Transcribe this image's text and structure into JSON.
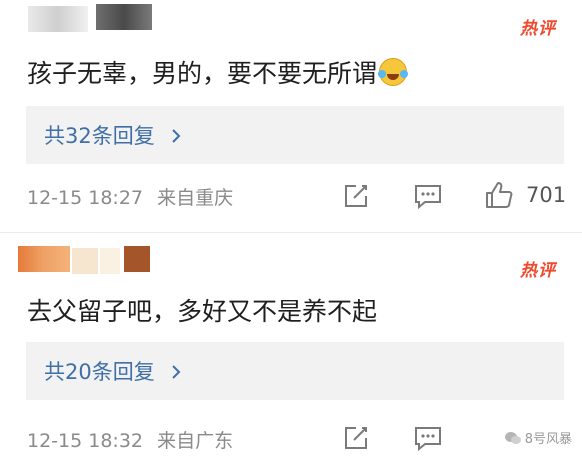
{
  "comments": [
    {
      "badge": "热评",
      "text": "孩子无辜，男的，要不要无所谓",
      "emoji": "laughing-tears-emoji",
      "replies_label": "共32条回复",
      "time": "12-15 18:27",
      "location": "来自重庆",
      "likes": "701"
    },
    {
      "badge": "热评",
      "text": "去父留子吧，多好又不是养不起",
      "replies_label": "共20条回复",
      "time": "12-15 18:32",
      "location": "来自广东"
    }
  ],
  "colors": {
    "badge": "#f04a2e",
    "link": "#3f6fa6",
    "meta": "#8a8a8a",
    "reply_bg": "#f2f2f2"
  },
  "watermark": "8号风暴"
}
